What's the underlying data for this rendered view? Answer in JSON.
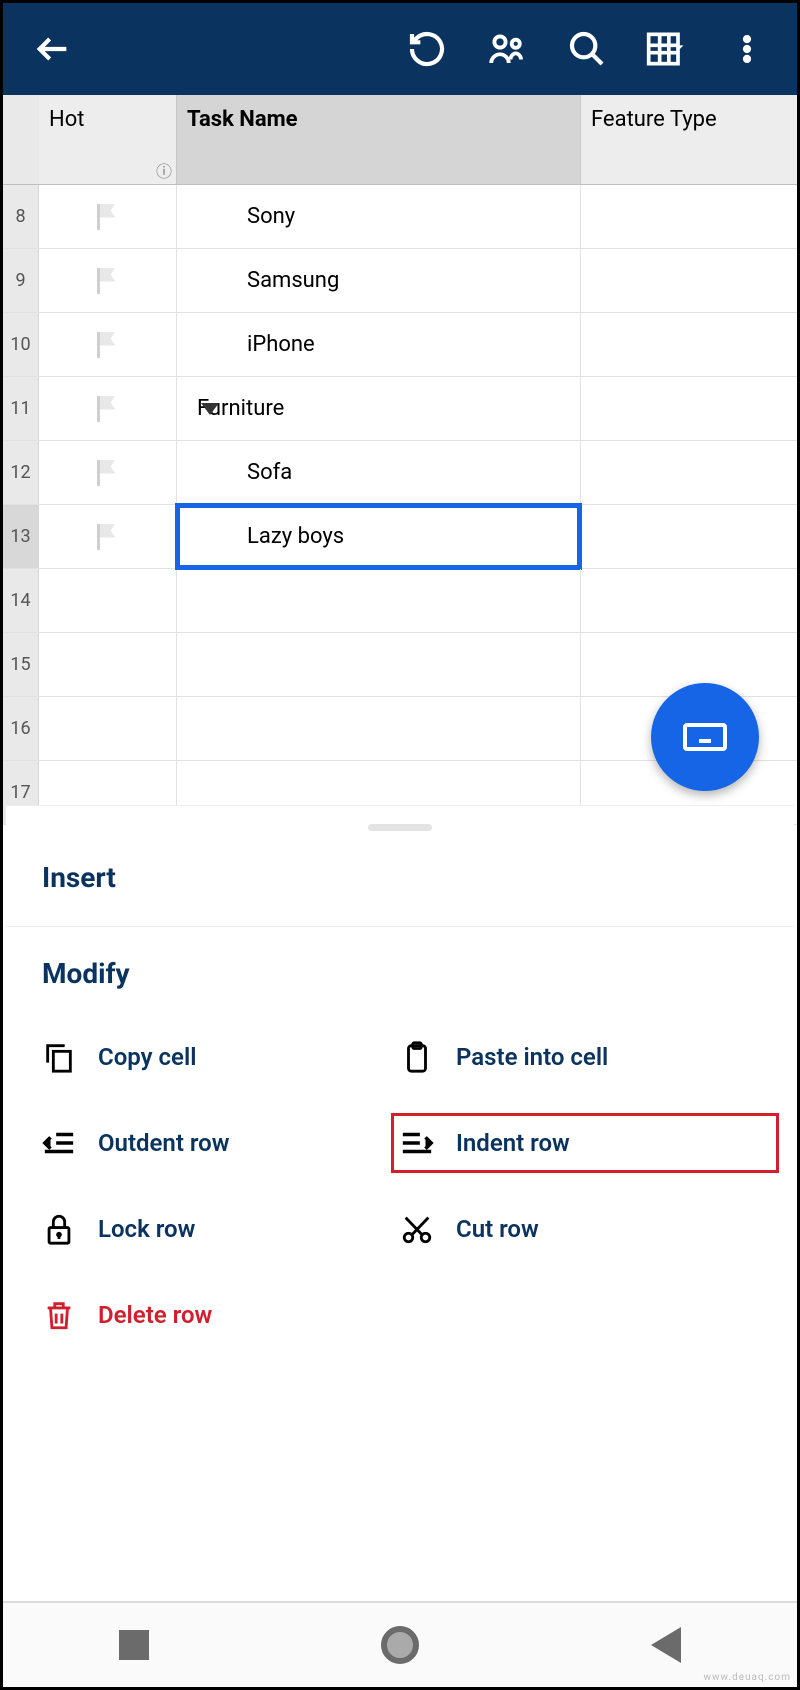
{
  "columns": {
    "hot": "Hot",
    "task": "Task Name",
    "feature": "Feature Type"
  },
  "rows": [
    {
      "n": "8",
      "task": "Sony",
      "indent": 2,
      "flag": true
    },
    {
      "n": "9",
      "task": "Samsung",
      "indent": 2,
      "flag": true
    },
    {
      "n": "10",
      "task": "iPhone",
      "indent": 2,
      "flag": true
    },
    {
      "n": "11",
      "task": "Furniture",
      "indent": 1,
      "flag": true,
      "expandable": true
    },
    {
      "n": "12",
      "task": "Sofa",
      "indent": 2,
      "flag": true
    },
    {
      "n": "13",
      "task": "Lazy boys",
      "indent": 2,
      "flag": true,
      "selected": true
    },
    {
      "n": "14",
      "task": "",
      "flag": false
    },
    {
      "n": "15",
      "task": "",
      "flag": false
    },
    {
      "n": "16",
      "task": "",
      "flag": false
    },
    {
      "n": "17",
      "task": "",
      "flag": false
    }
  ],
  "sheet": {
    "section1": "Insert",
    "section2": "Modify",
    "copy": "Copy cell",
    "paste": "Paste into cell",
    "outdent": "Outdent row",
    "indent": "Indent row",
    "lock": "Lock row",
    "cut": "Cut row",
    "delete": "Delete row"
  },
  "watermark": "www.deuaq.com"
}
